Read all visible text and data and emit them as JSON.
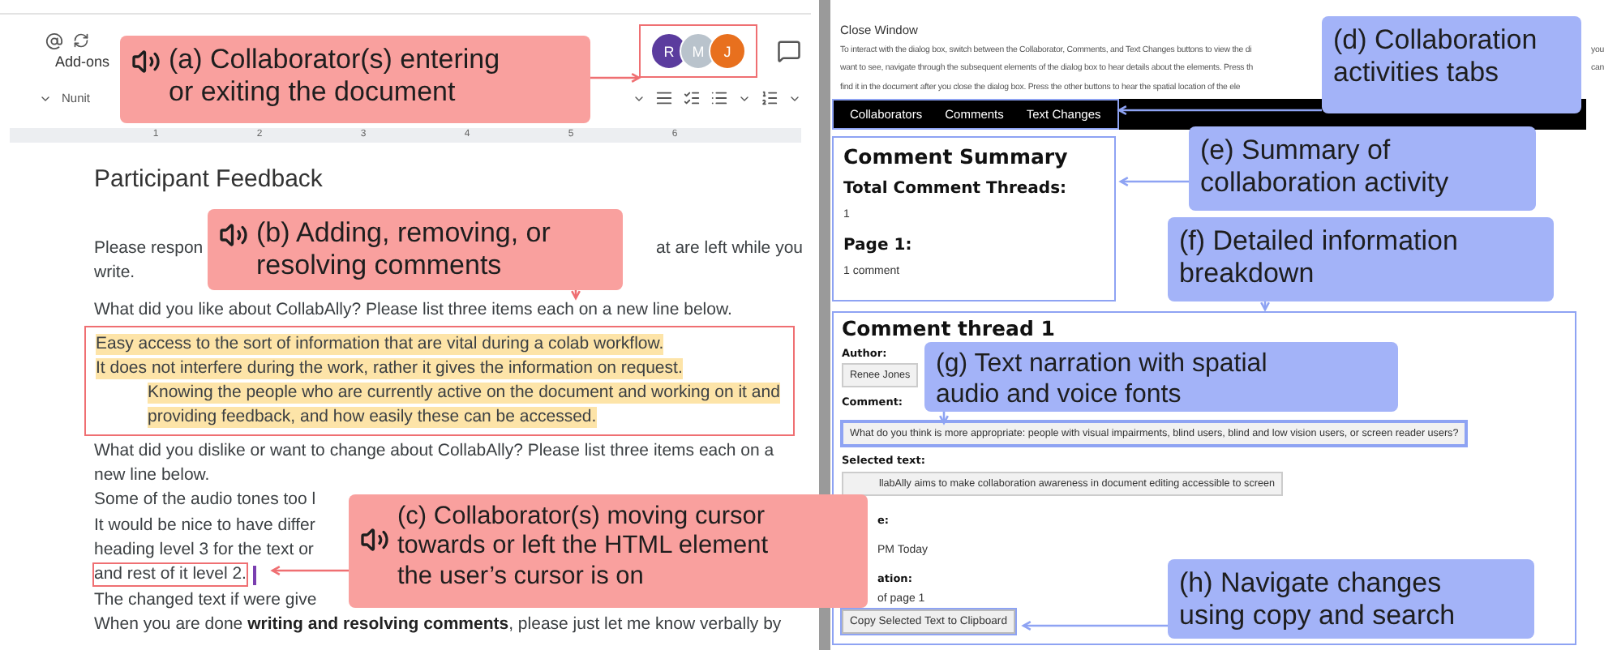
{
  "document": {
    "toolbar": {
      "menu_item": "Add-ons",
      "font": "Nunit",
      "collaborators": [
        {
          "initial": "R",
          "color": "#5b3c9e"
        },
        {
          "initial": "M",
          "color": "#b9c3cc"
        },
        {
          "initial": "J",
          "color": "#e8701e"
        }
      ]
    },
    "ruler_marks": [
      "1",
      "2",
      "3",
      "4",
      "5",
      "6"
    ],
    "title": "Participant Feedback",
    "paragraphs": [
      {
        "lines": [
          {
            "kind": "split",
            "text": "Please respon",
            "right": "at are left while you",
            "highlighted": false
          },
          {
            "kind": "text",
            "text": "write.",
            "highlighted": false
          }
        ]
      },
      {
        "lines": [
          {
            "kind": "text",
            "text": "What did you like about CollabAlly? Please list three items each on a new line below.",
            "highlighted": false
          },
          {
            "kind": "text",
            "text": "Easy access to the sort of information that are vital during a colab workflow.",
            "highlighted": true
          },
          {
            "kind": "text",
            "text": "It does not interfere during the work, rather it gives the information on request.",
            "highlighted": true
          },
          {
            "kind": "indented",
            "text": "Knowing the people who are currently active on the document and working on it and",
            "highlighted": true
          },
          {
            "kind": "indented",
            "text": "providing feedback, and how easily these can be accessed.",
            "highlighted": true
          },
          {
            "kind": "text",
            "text": "What did you dislike or want to change about CollabAlly? Please list three items each on a",
            "highlighted": false
          },
          {
            "kind": "text",
            "text": "new line below.",
            "highlighted": false
          },
          {
            "kind": "text",
            "text": "Some of the audio tones too l",
            "highlighted": false
          },
          {
            "kind": "text",
            "text": "It would be nice to have differ",
            "highlighted": false
          },
          {
            "kind": "text",
            "text": "heading level 3 for the text or",
            "highlighted": false
          },
          {
            "kind": "cursor",
            "text": "and rest of it level 2.",
            "highlighted": false
          },
          {
            "kind": "text",
            "text": "The changed text if were give",
            "highlighted": false
          },
          {
            "kind": "text",
            "text": "When you are done **writing and resolving comments**, please just let me know verbally by",
            "highlighted": false
          }
        ]
      }
    ]
  },
  "dialog": {
    "close": "Close Window",
    "instructions": [
      {
        "text": "To interact with the dialog box, switch between the Collaborator, Comments, and Text Changes buttons to view the di",
        "right": "you"
      },
      {
        "text": "want to see, navigate through the subsequent elements of the dialog box to hear details about the elements. Press th",
        "right": "can"
      },
      {
        "text": "find it in the document after you close the dialog box. Press the other buttons to hear the spatial location of the ele"
      }
    ],
    "tabs": [
      {
        "label": "Collaborators"
      },
      {
        "label": "Comments"
      },
      {
        "label": "Text Changes"
      }
    ],
    "summary": {
      "title": "Comment Summary",
      "threads_label": "Total Comment Threads:",
      "threads_value": "1",
      "page_label": "Page 1:",
      "page_value": "1 comment"
    },
    "thread": {
      "title": "Comment thread 1",
      "author_label": "Author:",
      "author": "Renee Jones",
      "comment_label": "Comment:",
      "comment": "What do you think is more appropriate: people with visual impairments, blind users, blind and low vision users, or screen reader users?",
      "selected_label": "Selected text:",
      "selected": "llabAlly aims to make collaboration awareness in document editing accessible to screen",
      "time_label": "e:",
      "time": "PM Today",
      "location_label": "ation:",
      "location": "of page 1",
      "copy_button": "Copy Selected Text to Clipboard"
    }
  },
  "callouts": [
    {
      "kind": "audio",
      "lines": [
        "(a) Collaborator(s) entering",
        "or exiting the document"
      ]
    },
    {
      "kind": "audio",
      "lines": [
        "(b) Adding, removing, or",
        "resolving comments"
      ]
    },
    {
      "kind": "audio",
      "lines": [
        "(c) Collaborator(s) moving cursor",
        "towards or left the HTML element",
        "the user’s cursor is on"
      ]
    },
    {
      "kind": "feature",
      "lines": [
        "(d) Collaboration",
        "activities tabs"
      ]
    },
    {
      "kind": "feature",
      "lines": [
        "(e) Summary of",
        "collaboration activity"
      ]
    },
    {
      "kind": "feature",
      "lines": [
        "(f) Detailed information",
        "breakdown"
      ]
    },
    {
      "kind": "feature",
      "lines": [
        "(g) Text narration with spatial",
        "audio and voice fonts"
      ]
    },
    {
      "kind": "feature",
      "lines": [
        "(h) Navigate changes",
        "using copy and search"
      ]
    }
  ]
}
